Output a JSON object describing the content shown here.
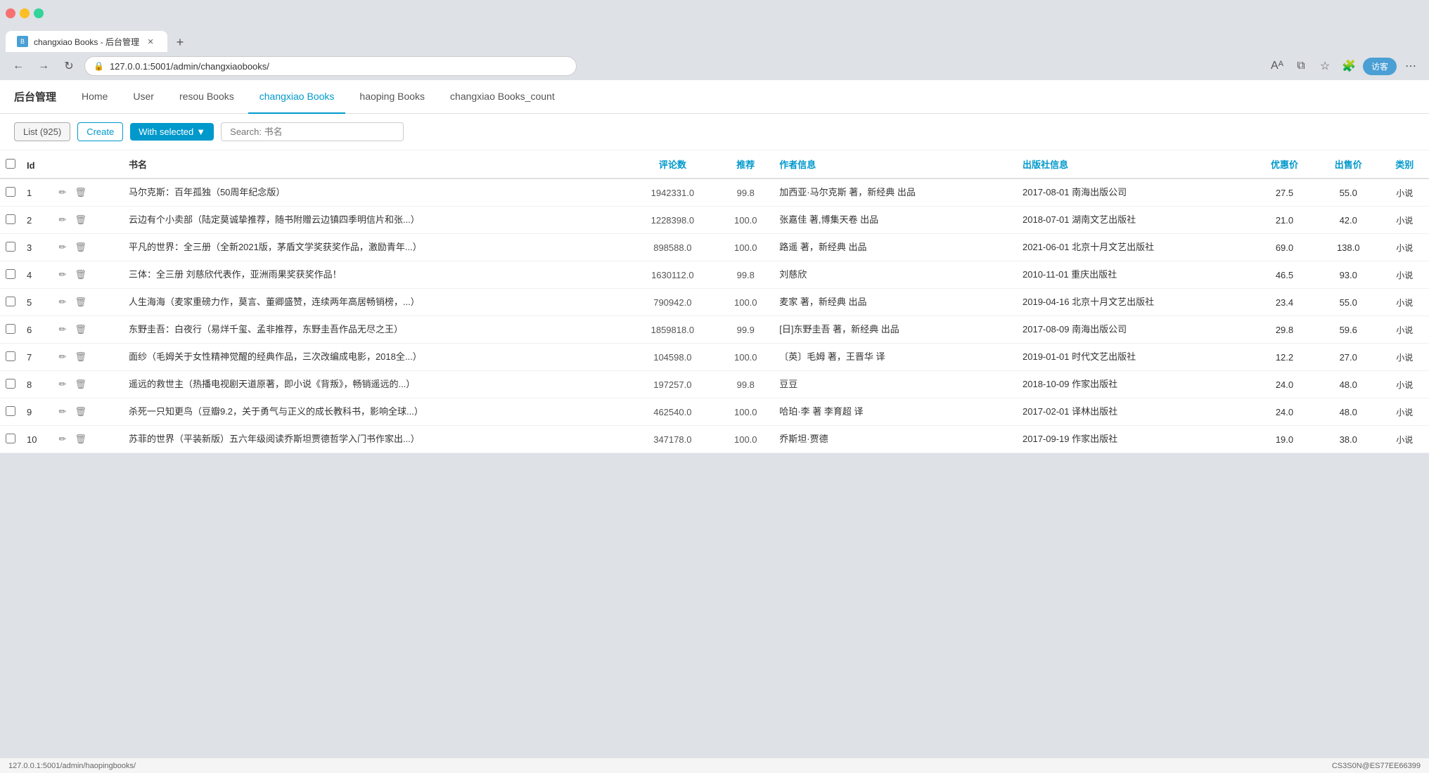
{
  "browser": {
    "tab_title": "changxiao Books - 后台管理",
    "url": "127.0.0.1:5001/admin/changxiaobooks/",
    "new_tab_tooltip": "+",
    "profile_label": "访客",
    "status_url": "127.0.0.1:5001/admin/haopingbooks/",
    "status_right": "CS3S0N@ES77EE66399"
  },
  "nav": {
    "brand": "后台管理",
    "items": [
      {
        "label": "Home",
        "active": false
      },
      {
        "label": "User",
        "active": false
      },
      {
        "label": "resou Books",
        "active": false
      },
      {
        "label": "changxiao Books",
        "active": true
      },
      {
        "label": "haoping Books",
        "active": false
      },
      {
        "label": "changxiao Books_count",
        "active": false
      }
    ]
  },
  "toolbar": {
    "list_label": "List (925)",
    "create_label": "Create",
    "with_selected_label": "With selected",
    "search_placeholder": "Search: 书名"
  },
  "table": {
    "headers": {
      "check": "",
      "id": "Id",
      "title": "书名",
      "reviews": "评论数",
      "recommend": "推荐",
      "author": "作者信息",
      "publisher": "出版社信息",
      "discount": "优惠价",
      "saleprice": "出售价",
      "category": "类别"
    },
    "rows": [
      {
        "id": 1,
        "title": "马尔克斯：百年孤独（50周年纪念版）",
        "reviews": "1942331.0",
        "recommend": "99.8",
        "author": "加西亚·马尔克斯 著，新经典 出品",
        "publisher": "2017-08-01 南海出版公司",
        "discount": "27.5",
        "saleprice": "55.0",
        "category": "小说"
      },
      {
        "id": 2,
        "title": "云边有个小卖部（陆定莫诚挚推荐，随书附赠云边镇四季明信片和张...）",
        "reviews": "1228398.0",
        "recommend": "100.0",
        "author": "张嘉佳 著,博集天卷 出品",
        "publisher": "2018-07-01 湖南文艺出版社",
        "discount": "21.0",
        "saleprice": "42.0",
        "category": "小说"
      },
      {
        "id": 3,
        "title": "平凡的世界：全三册（全新2021版，茅盾文学奖获奖作品，激励青年...）",
        "reviews": "898588.0",
        "recommend": "100.0",
        "author": "路遥 著，新经典 出品",
        "publisher": "2021-06-01 北京十月文艺出版社",
        "discount": "69.0",
        "saleprice": "138.0",
        "category": "小说"
      },
      {
        "id": 4,
        "title": "三体：全三册 刘慈欣代表作，亚洲雨果奖获奖作品！",
        "reviews": "1630112.0",
        "recommend": "99.8",
        "author": "刘慈欣",
        "publisher": "2010-11-01 重庆出版社",
        "discount": "46.5",
        "saleprice": "93.0",
        "category": "小说"
      },
      {
        "id": 5,
        "title": "人生海海（麦家重磅力作，莫言、董卿盛赞，连续两年高居畅销榜，...）",
        "reviews": "790942.0",
        "recommend": "100.0",
        "author": "麦家 著，新经典 出品",
        "publisher": "2019-04-16 北京十月文艺出版社",
        "discount": "23.4",
        "saleprice": "55.0",
        "category": "小说"
      },
      {
        "id": 6,
        "title": "东野圭吾：白夜行（易烊千玺、孟非推荐，东野圭吾作品无尽之王）",
        "reviews": "1859818.0",
        "recommend": "99.9",
        "author": "[日]东野圭吾 著，新经典 出品",
        "publisher": "2017-08-09 南海出版公司",
        "discount": "29.8",
        "saleprice": "59.6",
        "category": "小说"
      },
      {
        "id": 7,
        "title": "面纱（毛姆关于女性精神觉醒的经典作品，三次改编成电影，2018全...）",
        "reviews": "104598.0",
        "recommend": "100.0",
        "author": "〔英〕毛姆 著，王晋华 译",
        "publisher": "2019-01-01 时代文艺出版社",
        "discount": "12.2",
        "saleprice": "27.0",
        "category": "小说"
      },
      {
        "id": 8,
        "title": "遥远的救世主（热播电视剧天道原著，即小说《背叛》，畅销遥远的...）",
        "reviews": "197257.0",
        "recommend": "99.8",
        "author": "豆豆",
        "publisher": "2018-10-09 作家出版社",
        "discount": "24.0",
        "saleprice": "48.0",
        "category": "小说"
      },
      {
        "id": 9,
        "title": "杀死一只知更鸟（豆瓣9.2，关于勇气与正义的成长教科书，影响全球...）",
        "reviews": "462540.0",
        "recommend": "100.0",
        "author": "哈珀·李 著 李育超 译",
        "publisher": "2017-02-01 译林出版社",
        "discount": "24.0",
        "saleprice": "48.0",
        "category": "小说"
      },
      {
        "id": 10,
        "title": "苏菲的世界（平装新版）五六年级阅读乔斯坦贾德哲学入门书作家出...）",
        "reviews": "347178.0",
        "recommend": "100.0",
        "author": "乔斯坦·贾德",
        "publisher": "2017-09-19 作家出版社",
        "discount": "19.0",
        "saleprice": "38.0",
        "category": "小说"
      }
    ]
  }
}
